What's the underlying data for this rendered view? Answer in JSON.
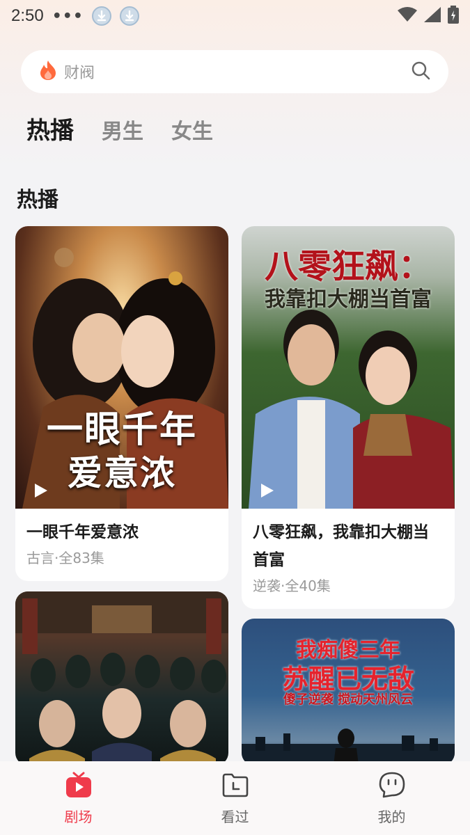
{
  "status_bar": {
    "time": "2:50",
    "dots": "•••"
  },
  "search": {
    "placeholder": "财阀"
  },
  "tabs": [
    {
      "label": "热播",
      "active": true
    },
    {
      "label": "男生",
      "active": false
    },
    {
      "label": "女生",
      "active": false
    }
  ],
  "section": {
    "title": "热播"
  },
  "cards": [
    {
      "title": "一眼千年爱意浓",
      "meta": "古言·全83集",
      "poster_text": [
        "一眼千年",
        "爱意浓"
      ]
    },
    {
      "title": "八零狂飙，我靠扣大棚当首富",
      "meta": "逆袭·全40集",
      "poster_text": [
        "八零狂飙：",
        "我靠扣大棚当首富"
      ]
    },
    {
      "title": "",
      "meta": "",
      "poster_text": []
    },
    {
      "title": "",
      "meta": "",
      "poster_text": [
        "我痴傻三年",
        "苏醒已无敌",
        "傻子逆袭 搅动天州风云"
      ]
    }
  ],
  "bottom_nav": [
    {
      "label": "剧场",
      "icon": "tv-play-icon",
      "active": true
    },
    {
      "label": "看过",
      "icon": "history-folder-icon",
      "active": false
    },
    {
      "label": "我的",
      "icon": "profile-face-icon",
      "active": false
    }
  ],
  "colors": {
    "accent": "#ef3b4b",
    "background": "#f3f3f5"
  }
}
